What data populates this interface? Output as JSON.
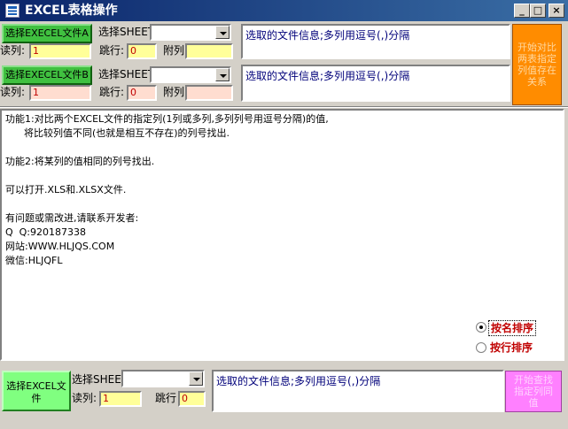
{
  "window": {
    "title": "EXCEL表格操作"
  },
  "controls": {
    "minimize": "_",
    "maximize": "□",
    "close": "×"
  },
  "fileA": {
    "select_button": "选择EXECEL文件A",
    "sheet_label": "选择SHEET",
    "sheet_value": "",
    "read_col_label": "读列:",
    "read_col_value": "1",
    "skip_row_label": "跳行:",
    "skip_row_value": "0",
    "extra_col_label": "附列",
    "extra_col_value": "",
    "info_text": "选取的文件信息;多列用逗号(,)分隔"
  },
  "fileB": {
    "select_button": "选择EXECEL文件B",
    "sheet_label": "选择SHEET",
    "sheet_value": "",
    "read_col_label": "读列:",
    "read_col_value": "1",
    "skip_row_label": "跳行:",
    "skip_row_value": "0",
    "extra_col_label": "附列",
    "extra_col_value": "",
    "info_text": "选取的文件信息;多列用逗号(,)分隔"
  },
  "compare_button": "开始对比两表指定列值存在关系",
  "info": {
    "lines": [
      "功能1:对比两个EXCEL文件的指定列(1列或多列,多列列号用逗号分隔)的值,",
      "      将比较列值不同(也就是相互不存在)的列号找出.",
      "",
      "功能2:将某列的值相同的列号找出.",
      "",
      "可以打开.XLS和.XLSX文件.",
      "",
      "有问题或需改进,请联系开发者:",
      "Q  Q:920187338",
      "网站:WWW.HLJQS.COM",
      "微信:HLJQFL"
    ]
  },
  "sort": {
    "by_name": "按名排序",
    "by_row": "按行排序",
    "selected": "by_name"
  },
  "bottom": {
    "select_button": "选择EXCEL文件",
    "sheet_label": "选择SHEET",
    "sheet_value": "",
    "read_col_label": "读列:",
    "read_col_value": "1",
    "skip_row_label": "跳行",
    "skip_row_value": "0",
    "info_text": "选取的文件信息;多列用逗号(,)分隔",
    "action_button": "开始查找指定列同值"
  }
}
